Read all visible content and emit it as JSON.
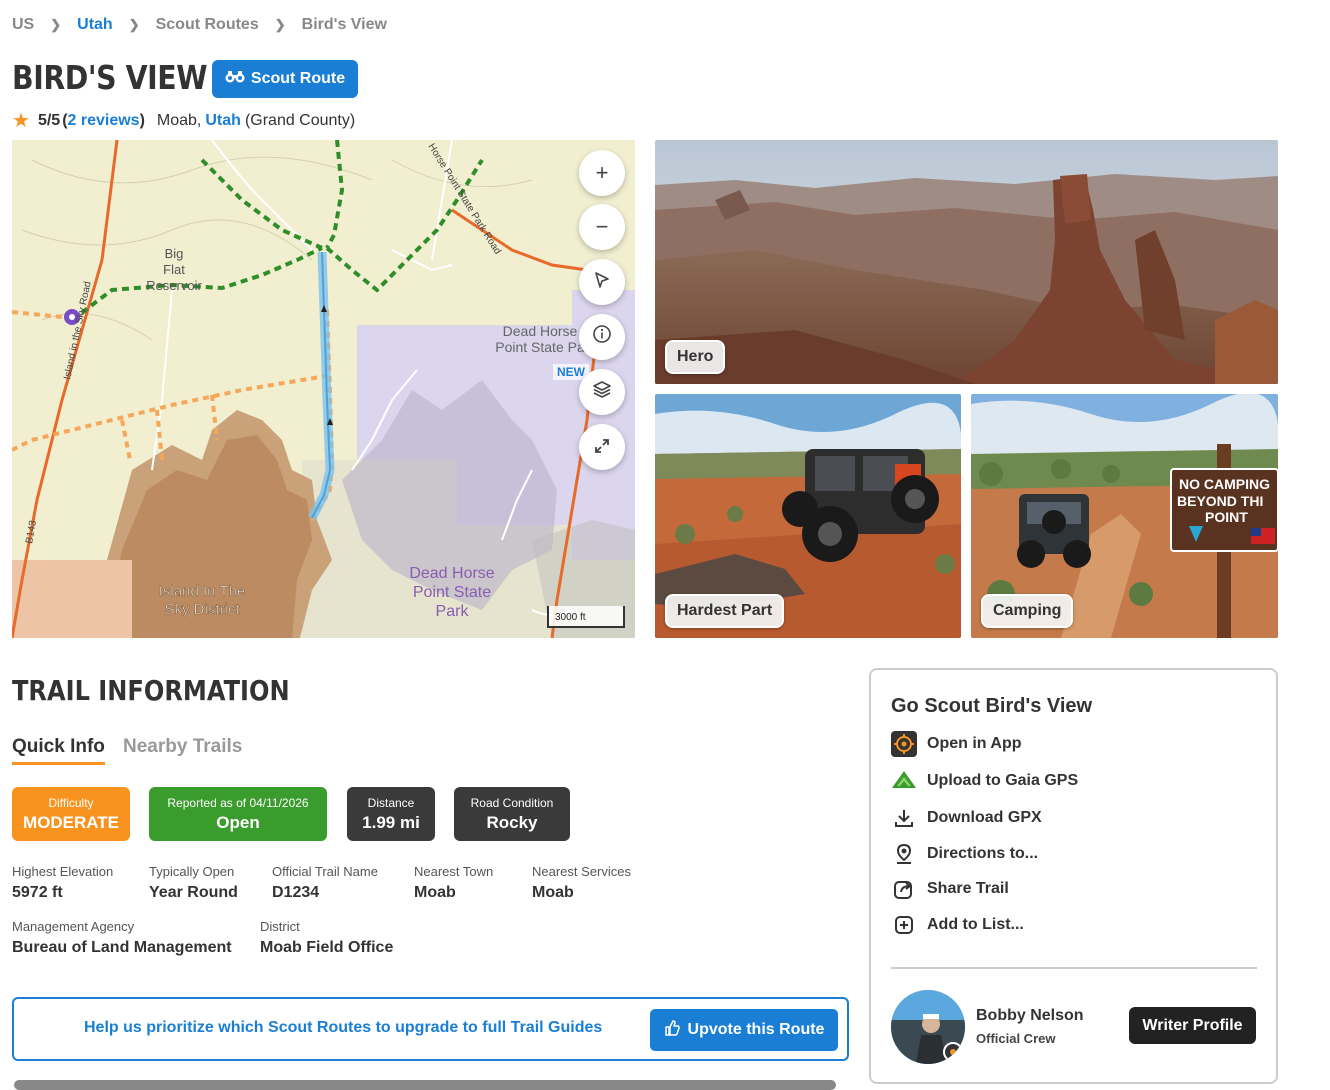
{
  "breadcrumb": {
    "items": [
      "US",
      "Utah",
      "Scout Routes",
      "Bird's View"
    ]
  },
  "header": {
    "title": "BIRD'S VIEW",
    "badge_label": "Scout Route"
  },
  "rating": {
    "score": "5/5",
    "open_paren": "(",
    "reviews": "2 reviews",
    "close_paren": ")",
    "city": "Moab,",
    "state": "Utah",
    "county": "(Grand County)"
  },
  "map": {
    "new_tag": "NEW",
    "scale": "3000 ft",
    "labels": {
      "big_flat": "Big",
      "big_flat2": "Flat",
      "reservoir": "Reservoir",
      "dead_horse": "Dead Horse",
      "point_state": "Point State Pa",
      "park_big1": "Dead Horse",
      "park_big2": "Point State",
      "park_big3": "Park",
      "island1": "Island In The",
      "island2": "Sky District",
      "road_island": "Island in the Sky Road",
      "road_horse": "Horse Point State Park Road",
      "b143": "B143"
    }
  },
  "photos": {
    "hero": "Hero",
    "hardest": "Hardest Part",
    "camping": "Camping",
    "sign1": "NO CAMPING",
    "sign2": "BEYOND THI",
    "sign3": "POINT"
  },
  "trail_info": {
    "title": "TRAIL INFORMATION",
    "tabs": [
      "Quick Info",
      "Nearby Trails"
    ],
    "pills": [
      {
        "label": "Difficulty",
        "value": "MODERATE",
        "color": "#f7931e"
      },
      {
        "label": "Reported as of 04/11/2026",
        "value": "Open",
        "color": "#3a9c2c"
      },
      {
        "label": "Distance",
        "value": "1.99 mi",
        "color": "#3a3a3a"
      },
      {
        "label": "Road Condition",
        "value": "Rocky",
        "color": "#3a3a3a"
      }
    ],
    "fields": [
      {
        "label": "Highest Elevation",
        "value": "5972 ft"
      },
      {
        "label": "Typically Open",
        "value": "Year Round"
      },
      {
        "label": "Official Trail Name",
        "value": "D1234"
      },
      {
        "label": "Nearest Town",
        "value": "Moab"
      },
      {
        "label": "Nearest Services",
        "value": "Moab"
      },
      {
        "label": "Management Agency",
        "value": "Bureau of Land Management"
      },
      {
        "label": "District",
        "value": "Moab Field Office"
      }
    ]
  },
  "upvote": {
    "text": "Help us prioritize which Scout Routes to upgrade to full Trail Guides",
    "button": "Upvote this Route"
  },
  "sidebar": {
    "title": "Go Scout Bird's View",
    "actions": [
      "Open in App",
      "Upload to Gaia GPS",
      "Download GPX",
      "Directions to...",
      "Share Trail",
      "Add to List..."
    ],
    "author_name": "Bobby Nelson",
    "author_role": "Official Crew",
    "writer_button": "Writer Profile"
  },
  "colors": {
    "accent": "#1a7fd4",
    "orange": "#f7931e",
    "green": "#3a9c2c",
    "dark": "#3a3a3a"
  }
}
